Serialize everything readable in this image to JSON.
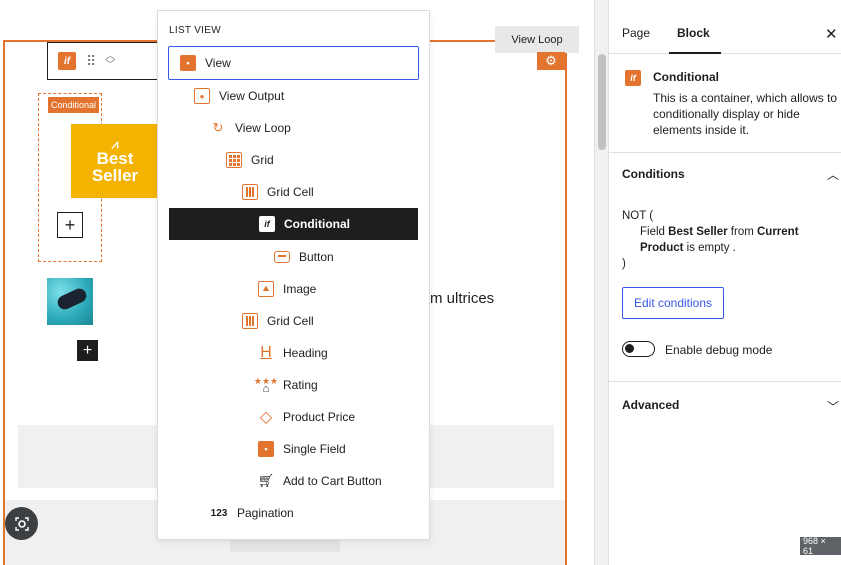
{
  "canvas": {
    "viewloop_tag": "View Loop",
    "conditional_label": "Conditional",
    "best_seller_line1": "Best",
    "best_seller_line2": "Seller",
    "body_text": "m ultrices"
  },
  "list_view": {
    "title": "LIST VIEW",
    "items": [
      {
        "label": "View",
        "icon": "calendar-icon"
      },
      {
        "label": "View Output",
        "icon": "eye-icon"
      },
      {
        "label": "View Loop",
        "icon": "loop-eye-icon"
      },
      {
        "label": "Grid",
        "icon": "grid-icon"
      },
      {
        "label": "Grid Cell",
        "icon": "column-icon"
      },
      {
        "label": "Conditional",
        "icon": "if-icon"
      },
      {
        "label": "Button",
        "icon": "button-icon"
      },
      {
        "label": "Image",
        "icon": "image-icon"
      },
      {
        "label": "Grid Cell",
        "icon": "column-icon"
      },
      {
        "label": "Heading",
        "icon": "heading-icon"
      },
      {
        "label": "Rating",
        "icon": "rating-icon"
      },
      {
        "label": "Product Price",
        "icon": "tag-icon"
      },
      {
        "label": "Single Field",
        "icon": "calendar-icon"
      },
      {
        "label": "Add to Cart Button",
        "icon": "cart-icon"
      },
      {
        "label": "Pagination",
        "icon": "number-icon"
      }
    ]
  },
  "sidebar": {
    "tabs": {
      "page": "Page",
      "block": "Block"
    },
    "block": {
      "title": "Conditional",
      "description": "This is a container, which allows to conditionally display or hide elements inside it."
    },
    "conditions": {
      "heading": "Conditions",
      "not_open": "NOT (",
      "field_word": "Field",
      "field_name": "Best Seller",
      "from_word": "from",
      "source_name": "Current",
      "source_name2": "Product",
      "is_empty": "is empty .",
      "close_paren": ")",
      "edit_button": "Edit conditions",
      "debug_label": "Enable debug mode"
    },
    "advanced_heading": "Advanced"
  },
  "badge": "968 × 61",
  "colors": {
    "accent": "#e3742f",
    "selection": "#3858e9",
    "selected_row": "#1e1e1e",
    "best_seller_bg": "#f5b301"
  }
}
